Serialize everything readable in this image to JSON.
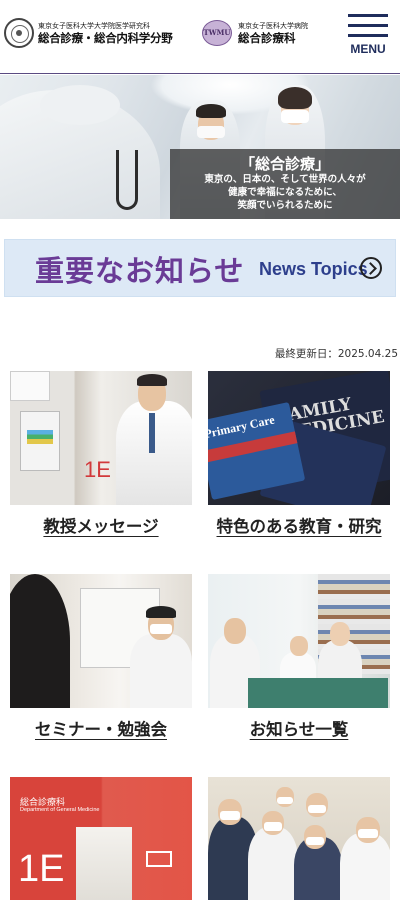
{
  "header": {
    "logo1": {
      "small": "東京女子医科大学大学院医学研究科",
      "title": "総合診療・総合内科学分野"
    },
    "logo2": {
      "emblem": "TWMU",
      "small": "東京女子医科大学病院",
      "title": "総合診療科"
    },
    "menu_label": "MENU"
  },
  "hero": {
    "title": "「総合診療」",
    "line1": "東京の、日本の、そして世界の人々が",
    "line2": "健康で幸福になるために、",
    "line3": "笑顔でいられるために"
  },
  "news": {
    "title_jp": "重要なお知らせ",
    "title_en": "News Topics"
  },
  "last_updated": "最終更新日：2025.04.25",
  "tiles": [
    {
      "label": "教授メッセージ"
    },
    {
      "label": "特色のある教育・研究"
    },
    {
      "label": "セミナー・勉強会"
    },
    {
      "label": "お知らせ一覧"
    },
    {
      "label": ""
    },
    {
      "label": ""
    }
  ],
  "images": {
    "prof_door": "1E",
    "edu_book_primary": "Primary Care",
    "edu_book_family": "FAMILY MEDICINE",
    "dept_sign_jp": "総合診療科",
    "dept_sign_en": "Department of General Medicine",
    "dept_room": "1E"
  },
  "colors": {
    "brand_purple": "#6a3b96",
    "navy": "#1f2d5c",
    "news_bg": "#dde9f6"
  }
}
